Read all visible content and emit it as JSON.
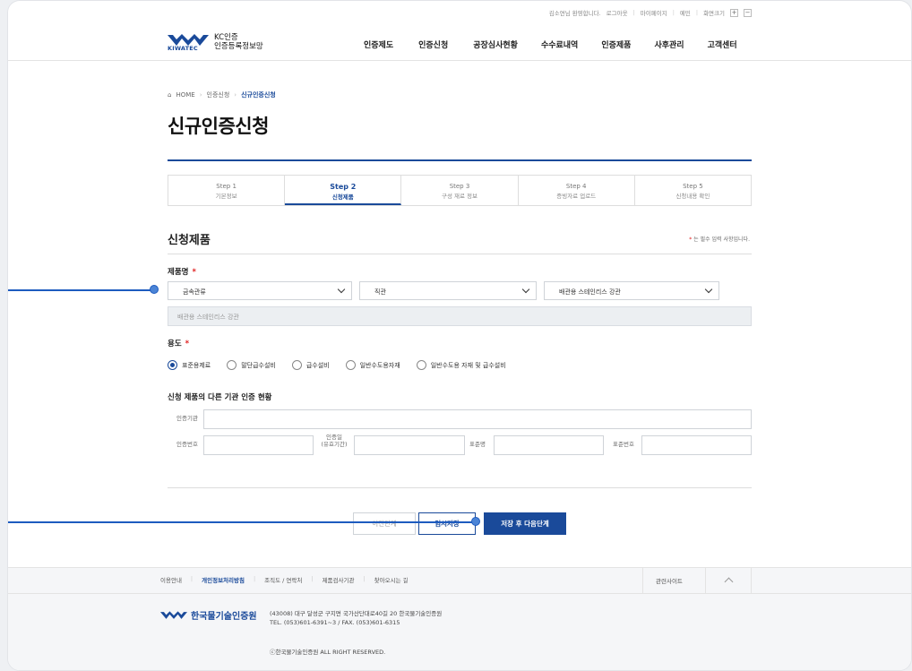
{
  "util": {
    "greeting": "김소연님 환영합니다.",
    "logout": "로그아웃",
    "mypage": "마이페이지",
    "en": "예민",
    "zoom_label": "화면크기",
    "zoom_in": "+",
    "zoom_out": "−"
  },
  "brand": {
    "sub": "KIWATEC",
    "line1": "KC인증",
    "line2": "인증등록정보망",
    "color": "#1a4a9a"
  },
  "gnb": [
    "인증제도",
    "인증신청",
    "공장심사현황",
    "수수료내역",
    "인증제품",
    "사후관리",
    "고객센터"
  ],
  "breadcrumb": {
    "home": "HOME",
    "level1": "인증신청",
    "current": "신규인증신청"
  },
  "page_title": "신규인증신청",
  "steps": [
    {
      "num": "Step 1",
      "label": "기본정보"
    },
    {
      "num": "Step 2",
      "label": "신청제품"
    },
    {
      "num": "Step 3",
      "label": "구성 재료 정보"
    },
    {
      "num": "Step 4",
      "label": "증빙자료 업로드"
    },
    {
      "num": "Step 5",
      "label": "신청내용 확인"
    }
  ],
  "active_step": 2,
  "section": {
    "title": "신청제품",
    "req_note": "는 필수 입력 사항입니다.",
    "req_star": "*"
  },
  "product": {
    "label": "제품명",
    "star": "*",
    "select1": "금속관류",
    "select2": "직관",
    "select3": "배관용 스테인리스 강관",
    "readonly_value": "배관용 스테인리스 강관"
  },
  "usage": {
    "label": "용도",
    "star": "*",
    "options": [
      "표준용제료",
      "말단급수설비",
      "급수설비",
      "일반수도용자재",
      "일반수도용 자재 및 급수설비"
    ],
    "selected": 0
  },
  "other_cert": {
    "title": "신청 제품의 다른 기관 인증 현황",
    "agency_label": "인증기관",
    "number_label": "인증번호",
    "period_label_1": "인증일",
    "period_label_2": "(유효기간)",
    "standard_name_label": "표준명",
    "standard_number_label": "표준번호"
  },
  "buttons": {
    "prev": "이전단계",
    "temp_save": "임시저장",
    "next": "저장 후 다음단계"
  },
  "footer": {
    "nav": [
      "이용안내",
      "개인정보처리방침",
      "조직도 / 연락처",
      "제품검사기관",
      "찾아오시는 길"
    ],
    "nav_highlight": 1,
    "related_sites": "관련사이트",
    "org_name": "한국물기술인증원",
    "address": "(43008) 대구 달성군 구지면 국가산단대로40길 20 한국물기술인증원",
    "contact": "TEL. (053)601-6391~3 / FAX. (053)601-6315",
    "copyright": "ⓒ한국물기술인증원 ALL RIGHT RESERVED."
  }
}
